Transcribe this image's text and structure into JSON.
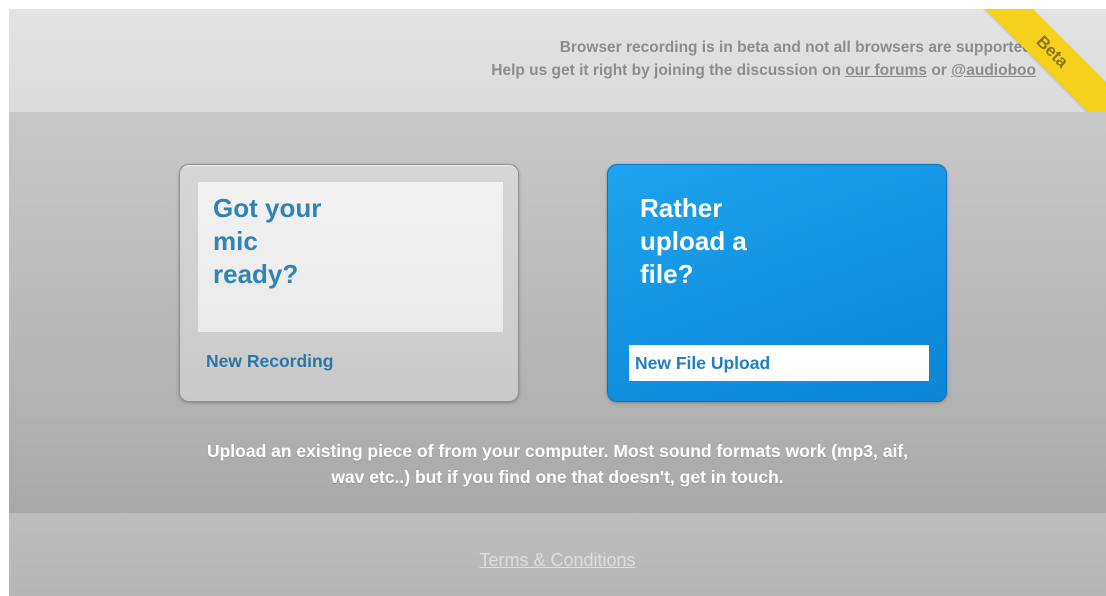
{
  "banner": {
    "line1": "Browser recording is in beta and not all browsers are supported.",
    "line2_prefix": "Help us get it right by joining the discussion on ",
    "forums_link": "our forums",
    "or_text": " or ",
    "twitter_link": "@audioboo",
    "beta_badge": "Beta"
  },
  "cards": {
    "record": {
      "heading_lines": [
        "Got your",
        "mic",
        "ready?"
      ],
      "action_label": "New Recording"
    },
    "upload": {
      "heading_lines": [
        "Rather",
        "upload a",
        "file?"
      ],
      "action_label": "New File Upload"
    }
  },
  "description": {
    "line1": "Upload an existing piece of from your computer. Most sound formats work (mp3, aif,",
    "line2": "wav etc..) but if you find one that doesn't, get in touch."
  },
  "footer": {
    "terms_link": "Terms & Conditions"
  },
  "colors": {
    "accent_blue": "#1191e0",
    "beta_yellow": "#f7d21c",
    "link_blue": "#2a78a8"
  }
}
